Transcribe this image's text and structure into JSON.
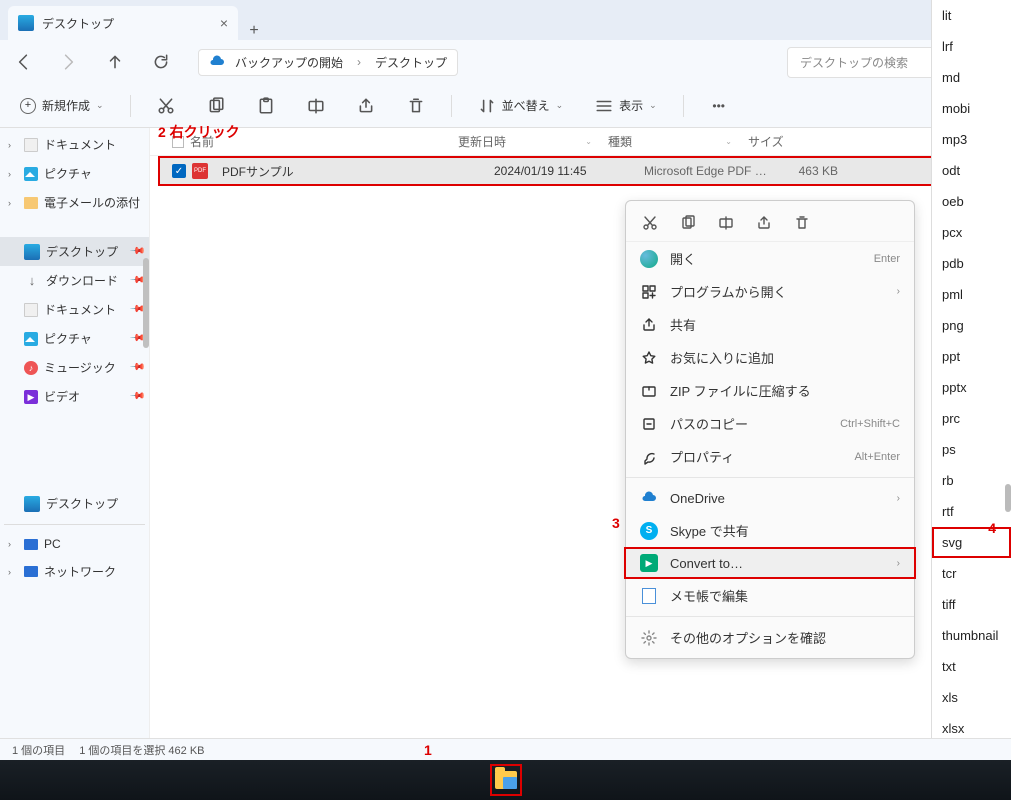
{
  "tab": {
    "title": "デスクトップ"
  },
  "breadcrumb": {
    "backup": "バックアップの開始",
    "loc": "デスクトップ"
  },
  "search": {
    "placeholder": "デスクトップの検索"
  },
  "toolbar": {
    "new": "新規作成",
    "sort": "並べ替え",
    "view": "表示"
  },
  "sidebar_upper": [
    {
      "label": "ドキュメント",
      "k": "doc"
    },
    {
      "label": "ピクチャ",
      "k": "pic"
    },
    {
      "label": "電子メールの添付",
      "k": "mail"
    }
  ],
  "sidebar_pinned": [
    {
      "label": "デスクトップ",
      "k": "desktop",
      "sel": true
    },
    {
      "label": "ダウンロード",
      "k": "dl"
    },
    {
      "label": "ドキュメント",
      "k": "doc"
    },
    {
      "label": "ピクチャ",
      "k": "pic"
    },
    {
      "label": "ミュージック",
      "k": "music"
    },
    {
      "label": "ビデオ",
      "k": "video"
    }
  ],
  "sidebar_home": {
    "label": "デスクトップ"
  },
  "sidebar_sys": [
    {
      "label": "PC",
      "k": "pc"
    },
    {
      "label": "ネットワーク",
      "k": "net"
    }
  ],
  "columns": {
    "name": "名前",
    "date": "更新日時",
    "type": "種類",
    "size": "サイズ"
  },
  "file": {
    "name": "PDFサンプル",
    "date": "2024/01/19 11:45",
    "type": "Microsoft Edge PDF …",
    "size": "463 KB"
  },
  "annotations": {
    "n1": "1",
    "n2": "2 右クリック",
    "n3": "3",
    "n4": "4"
  },
  "ctx": {
    "open": "開く",
    "open_sc": "Enter",
    "openwith": "プログラムから開く",
    "share": "共有",
    "fav": "お気に入りに追加",
    "zip": "ZIP ファイルに圧縮する",
    "copypath": "パスのコピー",
    "copypath_sc": "Ctrl+Shift+C",
    "props": "プロパティ",
    "props_sc": "Alt+Enter",
    "onedrive": "OneDrive",
    "skype": "Skype で共有",
    "convert": "Convert to…",
    "notepad": "メモ帳で編集",
    "more": "その他のオプションを確認"
  },
  "formats": [
    "lit",
    "lrf",
    "md",
    "mobi",
    "mp3",
    "odt",
    "oeb",
    "pcx",
    "pdb",
    "pml",
    "png",
    "ppt",
    "pptx",
    "prc",
    "ps",
    "rb",
    "rtf",
    "svg",
    "tcr",
    "tiff",
    "thumbnail",
    "txt",
    "xls",
    "xlsx"
  ],
  "format_highlight": "svg",
  "status": {
    "count": "1 個の項目",
    "selection": "1 個の項目を選択 462 KB"
  }
}
